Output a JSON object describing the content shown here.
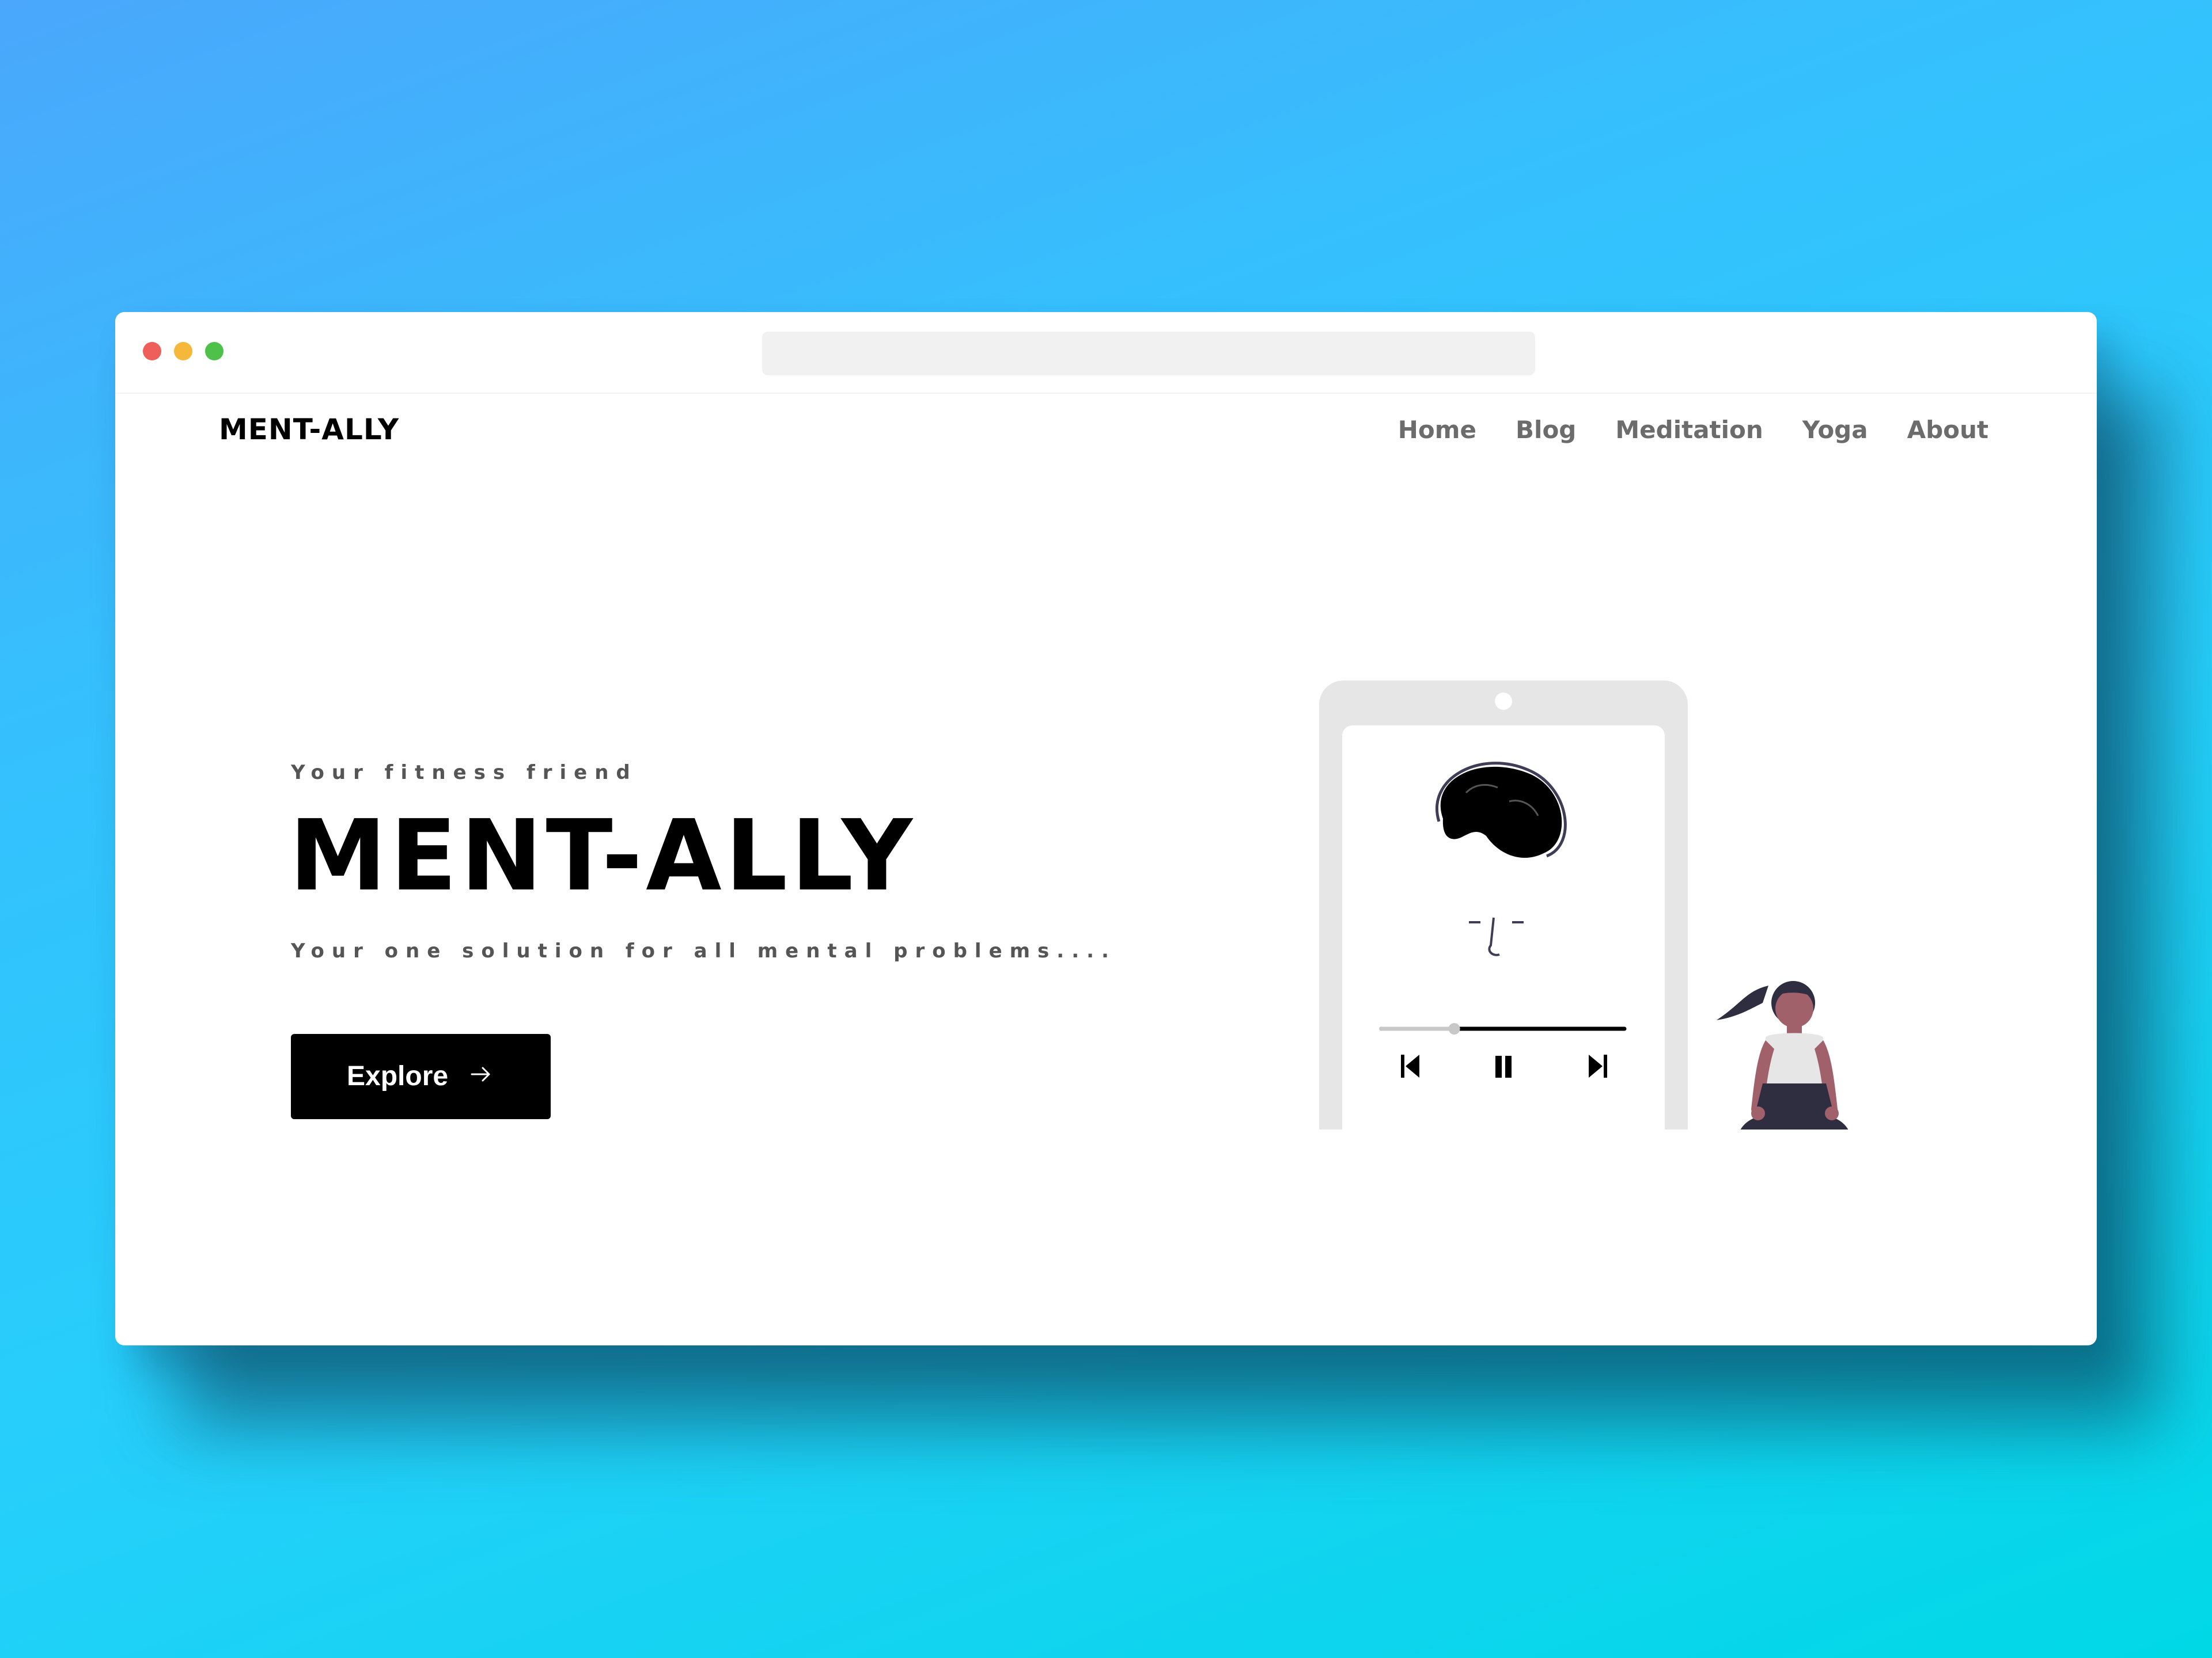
{
  "browser": {
    "url": ""
  },
  "site": {
    "logo": "MENT-ALLY"
  },
  "nav": {
    "items": [
      {
        "label": "Home"
      },
      {
        "label": "Blog"
      },
      {
        "label": "Meditation"
      },
      {
        "label": "Yoga"
      },
      {
        "label": "About"
      }
    ]
  },
  "hero": {
    "tagline": "Your fitness friend",
    "title": "MENT-ALLY",
    "subtitle": "Your one solution for all mental problems....",
    "button_label": "Explore"
  },
  "player": {
    "progress": 0.3
  },
  "colors": {
    "accent": "#000000",
    "nav_text": "#6c6c6c",
    "tablet": "#e6e6e6"
  },
  "icons": [
    "arrow-right-icon",
    "skip-back-icon",
    "pause-icon",
    "skip-forward-icon"
  ]
}
